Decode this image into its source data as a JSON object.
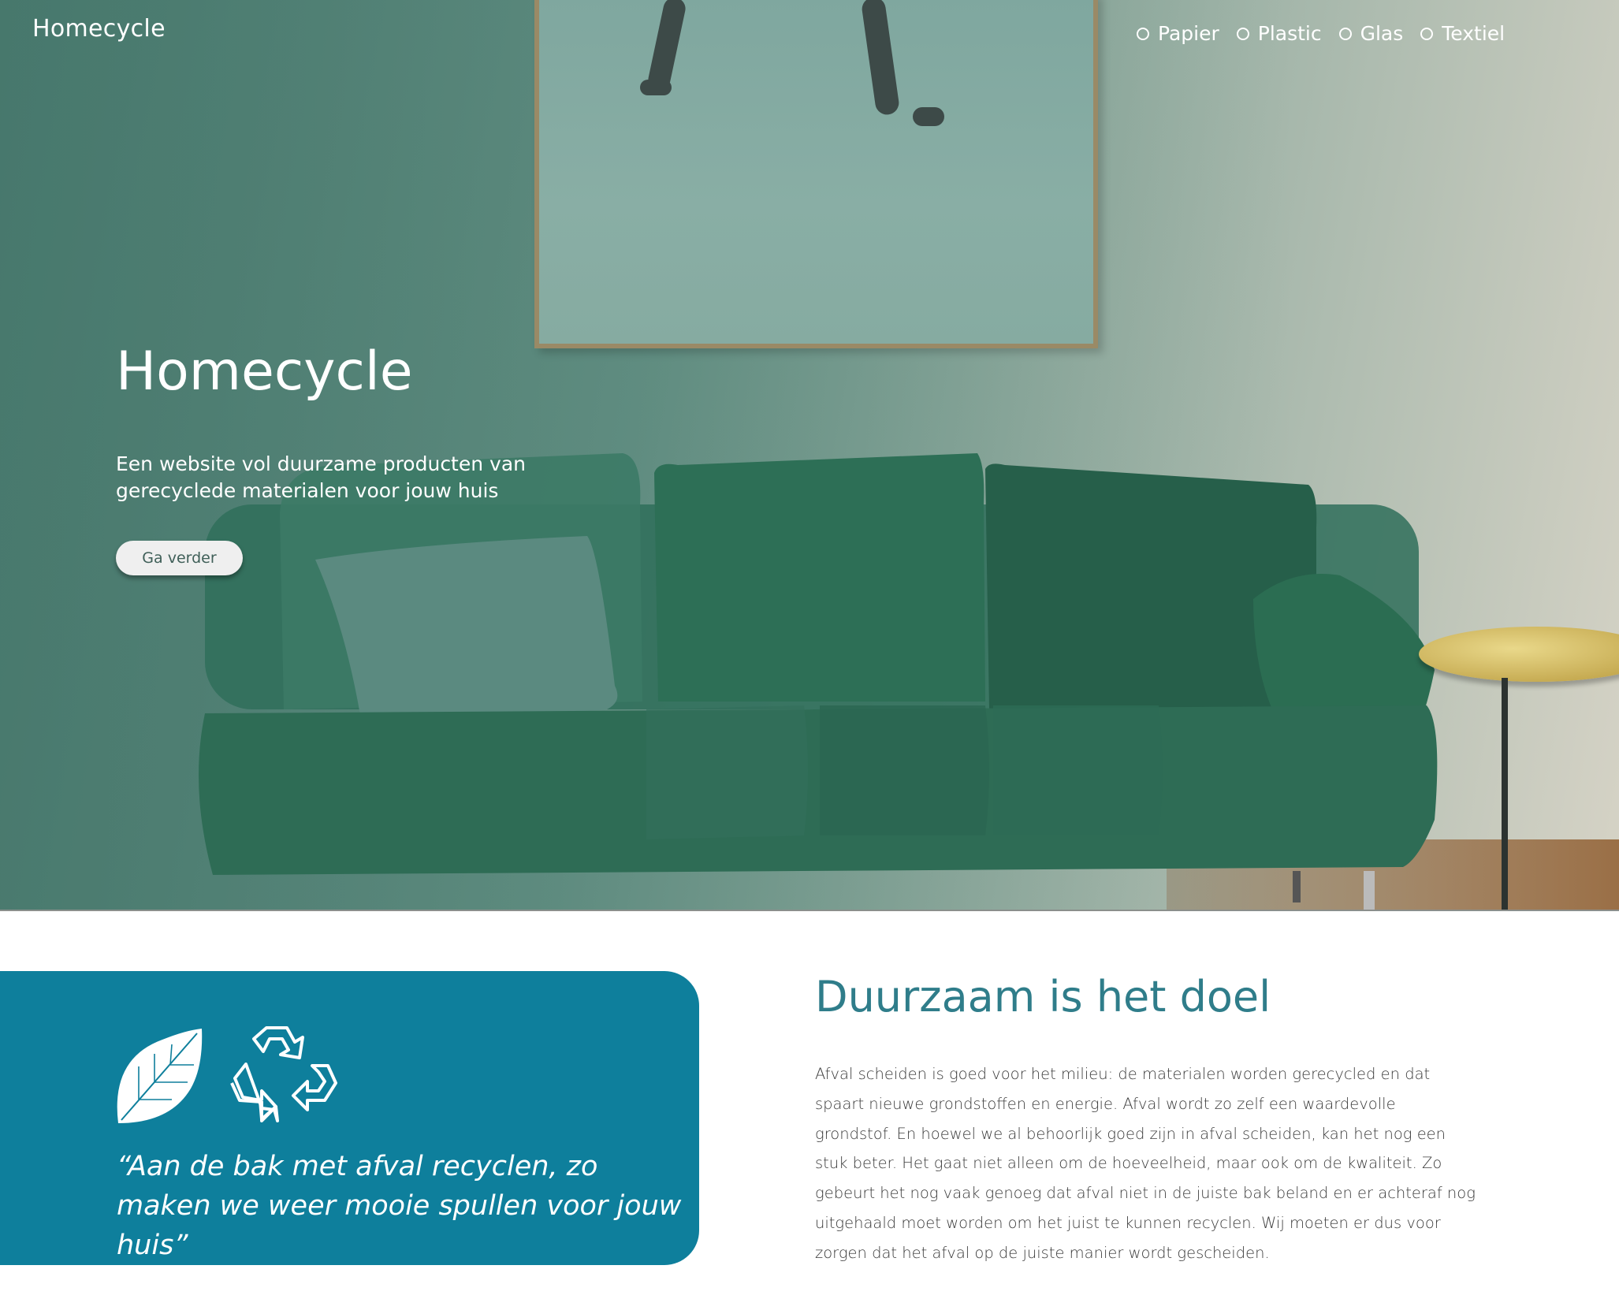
{
  "header": {
    "brand": "Homecycle",
    "nav": [
      {
        "label": "Papier"
      },
      {
        "label": "Plastic"
      },
      {
        "label": "Glas"
      },
      {
        "label": "Textiel"
      }
    ]
  },
  "hero": {
    "title": "Homecycle",
    "subtitle": "Een website vol duurzame producten van gerecyclede materialen voor jouw huis",
    "button_label": "Ga verder"
  },
  "quote_card": {
    "icons": [
      "leaf-icon",
      "recycle-icon"
    ],
    "quote": "“Aan de bak met afval recyclen, zo maken we weer mooie spullen voor jouw huis”",
    "color": "#0e7f9c"
  },
  "intro": {
    "title": "Duurzaam is het doel",
    "body": "Afval scheiden is goed voor het milieu: de materialen worden gerecycled en dat spaart nieuwe grondstoffen en energie. Afval wordt zo zelf een waardevolle grondstof. En hoewel we al behoorlijk goed zijn in afval scheiden, kan het nog een stuk beter. Het gaat niet alleen om de hoeveelheid, maar ook om de kwaliteit. Zo gebeurt het nog vaak genoeg dat afval niet in de juiste bak beland en er achteraf nog uitgehaald moet worden om het juist te kunnen recyclen. Wij moeten er dus voor zorgen dat het afval op de juiste manier wordt gescheiden."
  },
  "colors": {
    "accent": "#2f7d8a",
    "hero_tint": "#4f7e74"
  }
}
